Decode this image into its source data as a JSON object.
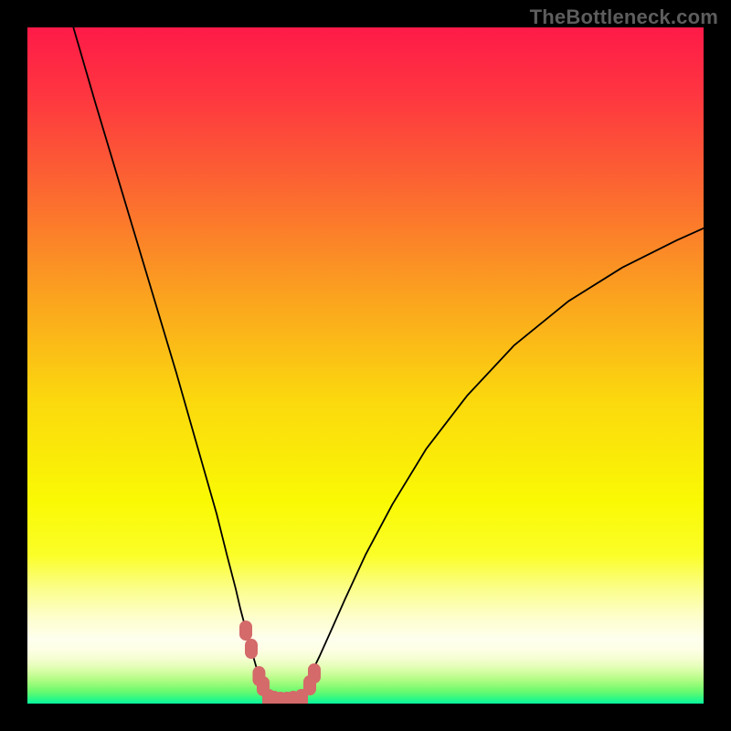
{
  "watermark": "TheBottleneck.com",
  "chart_data": {
    "type": "line",
    "title": "",
    "xlabel": "",
    "ylabel": "",
    "xlim": [
      0,
      100
    ],
    "ylim": [
      0,
      100
    ],
    "grid": false,
    "legend": false,
    "series": [
      {
        "name": "left-branch",
        "x": [
          6.8,
          10,
          13,
          16,
          19,
          22,
          24,
          26,
          28,
          29.5,
          30.8,
          31.5,
          32.3,
          33.1,
          34.25,
          34.9,
          35.68
        ],
        "values": [
          100,
          89,
          79,
          69,
          59,
          49,
          42,
          35,
          28,
          22,
          17,
          14,
          11,
          8,
          4,
          2.6,
          0.68
        ]
      },
      {
        "name": "right-branch",
        "x": [
          40.54,
          41.2,
          42,
          43.2,
          45,
          47,
          50,
          54,
          59,
          65,
          72,
          80,
          88,
          96,
          100
        ],
        "values": [
          0.68,
          2.5,
          4.5,
          7,
          11,
          15.5,
          22,
          29.5,
          37.7,
          45.5,
          53,
          59.5,
          64.5,
          68.5,
          70.3
        ]
      },
      {
        "name": "valley-floor",
        "x": [
          35.68,
          36.5,
          37.5,
          38.5,
          39.5,
          40.54
        ],
        "values": [
          0.68,
          0.41,
          0.27,
          0.27,
          0.41,
          0.68
        ]
      }
    ],
    "markers": {
      "name": "capsule-markers",
      "color": "#d46a6a",
      "x": [
        32.3,
        33.11,
        34.25,
        34.86,
        35.68,
        36.49,
        37.43,
        38.38,
        39.32,
        40.54,
        41.76,
        42.43
      ],
      "values": [
        10.8,
        8.1,
        4.05,
        2.57,
        0.68,
        0.41,
        0.27,
        0.27,
        0.41,
        0.68,
        2.7,
        4.46
      ]
    },
    "background": {
      "type": "vertical-gradient",
      "stops": [
        {
          "pct": 0,
          "color": "#fe1a48"
        },
        {
          "pct": 10,
          "color": "#fe3640"
        },
        {
          "pct": 22,
          "color": "#fc6033"
        },
        {
          "pct": 38,
          "color": "#fb9c21"
        },
        {
          "pct": 55,
          "color": "#fbd80e"
        },
        {
          "pct": 70,
          "color": "#faf904"
        },
        {
          "pct": 78,
          "color": "#fbfe27"
        },
        {
          "pct": 83,
          "color": "#fbfe8a"
        },
        {
          "pct": 87,
          "color": "#fdfec9"
        },
        {
          "pct": 90.5,
          "color": "#feffee"
        },
        {
          "pct": 92,
          "color": "#feffe5"
        },
        {
          "pct": 93.4,
          "color": "#f4fed1"
        },
        {
          "pct": 94.6,
          "color": "#e3feb6"
        },
        {
          "pct": 95.6,
          "color": "#cbfd9a"
        },
        {
          "pct": 96.5,
          "color": "#b0fc84"
        },
        {
          "pct": 97.3,
          "color": "#91fb76"
        },
        {
          "pct": 98.0,
          "color": "#72fa70"
        },
        {
          "pct": 98.7,
          "color": "#4ff977"
        },
        {
          "pct": 99.3,
          "color": "#2bf887"
        },
        {
          "pct": 100,
          "color": "#08f89e"
        }
      ]
    }
  }
}
